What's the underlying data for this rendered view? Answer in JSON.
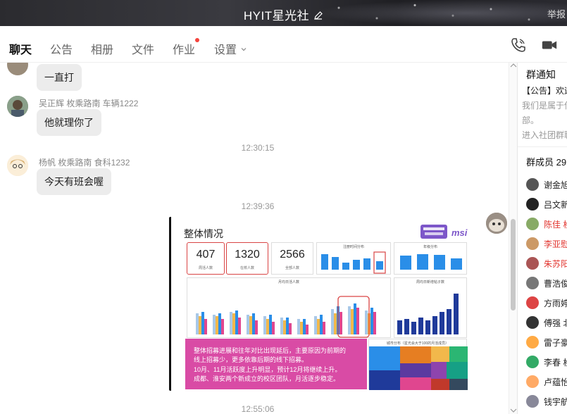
{
  "header": {
    "title": "HYIT星光社",
    "report": "举报"
  },
  "tabs": [
    {
      "label": "聊天",
      "active": true
    },
    {
      "label": "公告"
    },
    {
      "label": "相册"
    },
    {
      "label": "文件"
    },
    {
      "label": "作业",
      "badge_dot": true
    },
    {
      "label": "设置",
      "has_dropdown": true
    }
  ],
  "icons": {
    "voice_call": "phone-icon",
    "video_call": "video-camera-icon"
  },
  "messages": [
    {
      "sender": "",
      "text": "一直打"
    },
    {
      "sender": "吴正辉 枚乘路南 车辆1222",
      "text": "他就理你了"
    },
    {
      "time": "12:30:15"
    },
    {
      "sender": "杨帆 枚乘路南 食科1232",
      "text": "今天有班会喔"
    },
    {
      "time": "12:39:36"
    },
    {
      "image": {
        "title": "整体情况",
        "logo_text": "msi",
        "kpis": [
          {
            "value": "407",
            "label": "周活人数"
          },
          {
            "value": "1320",
            "label": "在校人数"
          },
          {
            "value": "2566",
            "label": "全部人数"
          }
        ],
        "panels": [
          "注册时间分布",
          "年级分布",
          "月均日活人数",
          "周均日新增帖子数",
          "城市分布（星光会大于100的月活成员）"
        ],
        "notes": [
          "整体招募进展和往年对比出现延后，主要原因为前期的",
          "线上招募少，更多依靠后期的线下招募。",
          "10月、11月活跃度上升明显，预计12月将继续上升。",
          "成都、淮安两个新成立的校区团队，月活逐步稳定。"
        ]
      }
    },
    {
      "time": "12:55:06"
    }
  ],
  "side": {
    "notice_title": "群通知",
    "notice_lines": [
      "【公告】欢迎",
      "我们是属于你",
      "部。",
      "进入社团群聊"
    ],
    "members_title": "群成员 29",
    "members": [
      {
        "name": "谢金旭",
        "color": "#555"
      },
      {
        "name": "吕文新",
        "color": "#222"
      },
      {
        "name": "陈佳 枚",
        "color": "#8a6",
        "red": true
      },
      {
        "name": "李亚慰",
        "color": "#c96",
        "red": true
      },
      {
        "name": "朱苏阳",
        "color": "#a55",
        "red": true
      },
      {
        "name": "曹浩俊",
        "color": "#777"
      },
      {
        "name": "方雨婷",
        "color": "#d44"
      },
      {
        "name": "傅强 北",
        "color": "#333"
      },
      {
        "name": "雷子豪",
        "color": "#fa4"
      },
      {
        "name": "李春 枚",
        "color": "#3a6"
      },
      {
        "name": "卢蕴怡",
        "color": "#fa6"
      },
      {
        "name": "钱宇航",
        "color": "#889"
      }
    ]
  }
}
